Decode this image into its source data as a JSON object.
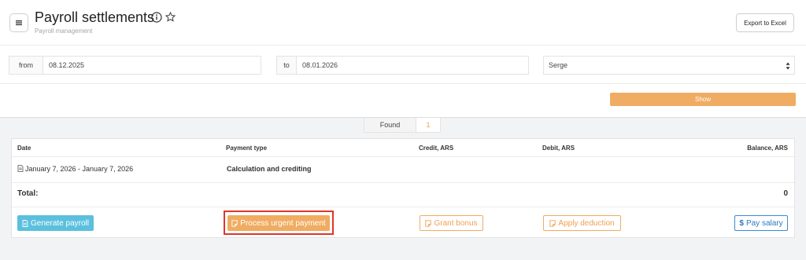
{
  "header": {
    "title": "Payroll settlements",
    "subtitle": "Payroll management",
    "export_label": "Export to Excel"
  },
  "filters": {
    "from_label": "from",
    "from_value": "08.12.2025",
    "to_label": "to",
    "to_value": "08.01.2026",
    "employee_value": "Serge",
    "show_label": "Show"
  },
  "found": {
    "label": "Found",
    "count": "1"
  },
  "table": {
    "columns": [
      "Date",
      "Payment type",
      "Credit, ARS",
      "Debit, ARS",
      "Balance, ARS"
    ],
    "rows": [
      {
        "date": "January 7, 2026 - January 7, 2026",
        "payment_type": "Calculation and crediting",
        "credit": "",
        "debit": "",
        "balance": ""
      }
    ],
    "total_label": "Total:",
    "total_value": "0"
  },
  "actions": {
    "generate": "Generate payroll",
    "urgent": "Process urgent payment",
    "bonus": "Grant bonus",
    "deduction": "Apply deduction",
    "pay": "Pay salary"
  },
  "icons": {
    "menu": "hamburger-icon",
    "info": "info-icon",
    "star": "star-icon",
    "select": "select-arrows-icon",
    "document": "document-icon",
    "dollar": "dollar-icon"
  },
  "colors": {
    "accent_orange": "#f0ac62",
    "info_blue": "#5bc0de",
    "primary_blue": "#2c77c4",
    "highlight_red": "#e0352b"
  }
}
